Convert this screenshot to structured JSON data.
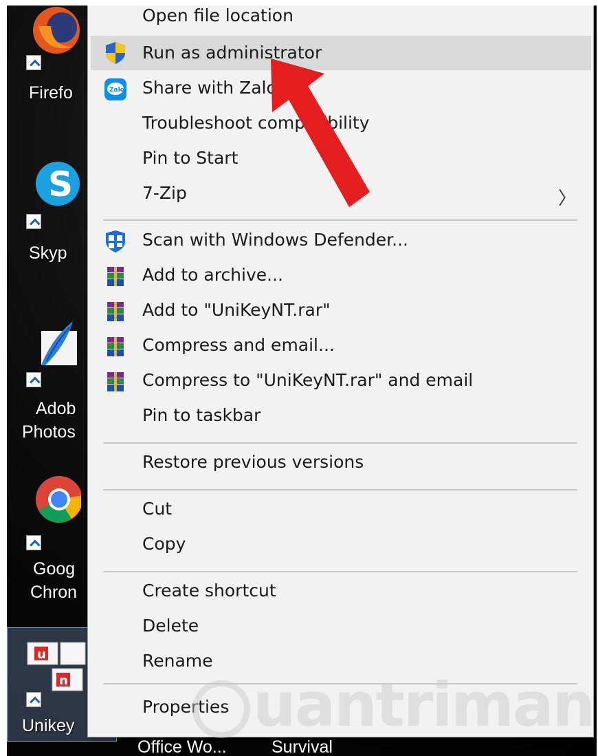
{
  "desktop": {
    "icons": [
      {
        "label": "Firefo",
        "icon": "firefox-icon"
      },
      {
        "label": "Skyp",
        "icon": "skype-icon"
      },
      {
        "label": "Adob",
        "label2": "Photos",
        "icon": "photoshop-icon"
      },
      {
        "label": "Goog",
        "label2": "Chron",
        "icon": "chrome-icon"
      },
      {
        "label": "Unikey",
        "icon": "unikey-icon"
      }
    ],
    "bottom_labels": [
      "Office Wo...",
      "Survival"
    ]
  },
  "context_menu": {
    "items": [
      {
        "label": "Open file location",
        "icon": ""
      },
      {
        "label": "Run as administrator",
        "icon": "uac-shield-icon",
        "highlighted": true
      },
      {
        "label": "Share with Zalo",
        "icon": "zalo-icon"
      },
      {
        "label": "Troubleshoot compatibility",
        "icon": ""
      },
      {
        "label": "Pin to Start",
        "icon": ""
      },
      {
        "label": "7-Zip",
        "icon": "",
        "submenu_arrow": "〉"
      },
      {
        "label": "Scan with Windows Defender...",
        "icon": "windows-defender-icon"
      },
      {
        "label": "Add to archive...",
        "icon": "winrar-icon"
      },
      {
        "label": "Add to \"UniKeyNT.rar\"",
        "icon": "winrar-icon"
      },
      {
        "label": "Compress and email...",
        "icon": "winrar-icon"
      },
      {
        "label": "Compress to \"UniKeyNT.rar\" and email",
        "icon": "winrar-icon"
      },
      {
        "label": "Pin to taskbar",
        "icon": ""
      },
      {
        "label": "Restore previous versions",
        "icon": ""
      },
      {
        "label": "Cut",
        "icon": ""
      },
      {
        "label": "Copy",
        "icon": ""
      },
      {
        "label": "Create shortcut",
        "icon": ""
      },
      {
        "label": "Delete",
        "icon": ""
      },
      {
        "label": "Rename",
        "icon": ""
      },
      {
        "label": "Properties",
        "icon": ""
      }
    ]
  },
  "watermark": "uantrimang",
  "colors": {
    "highlight": "#d9d9d9",
    "menu_bg": "#f2f2f2",
    "arrow": "#e41e1e"
  }
}
